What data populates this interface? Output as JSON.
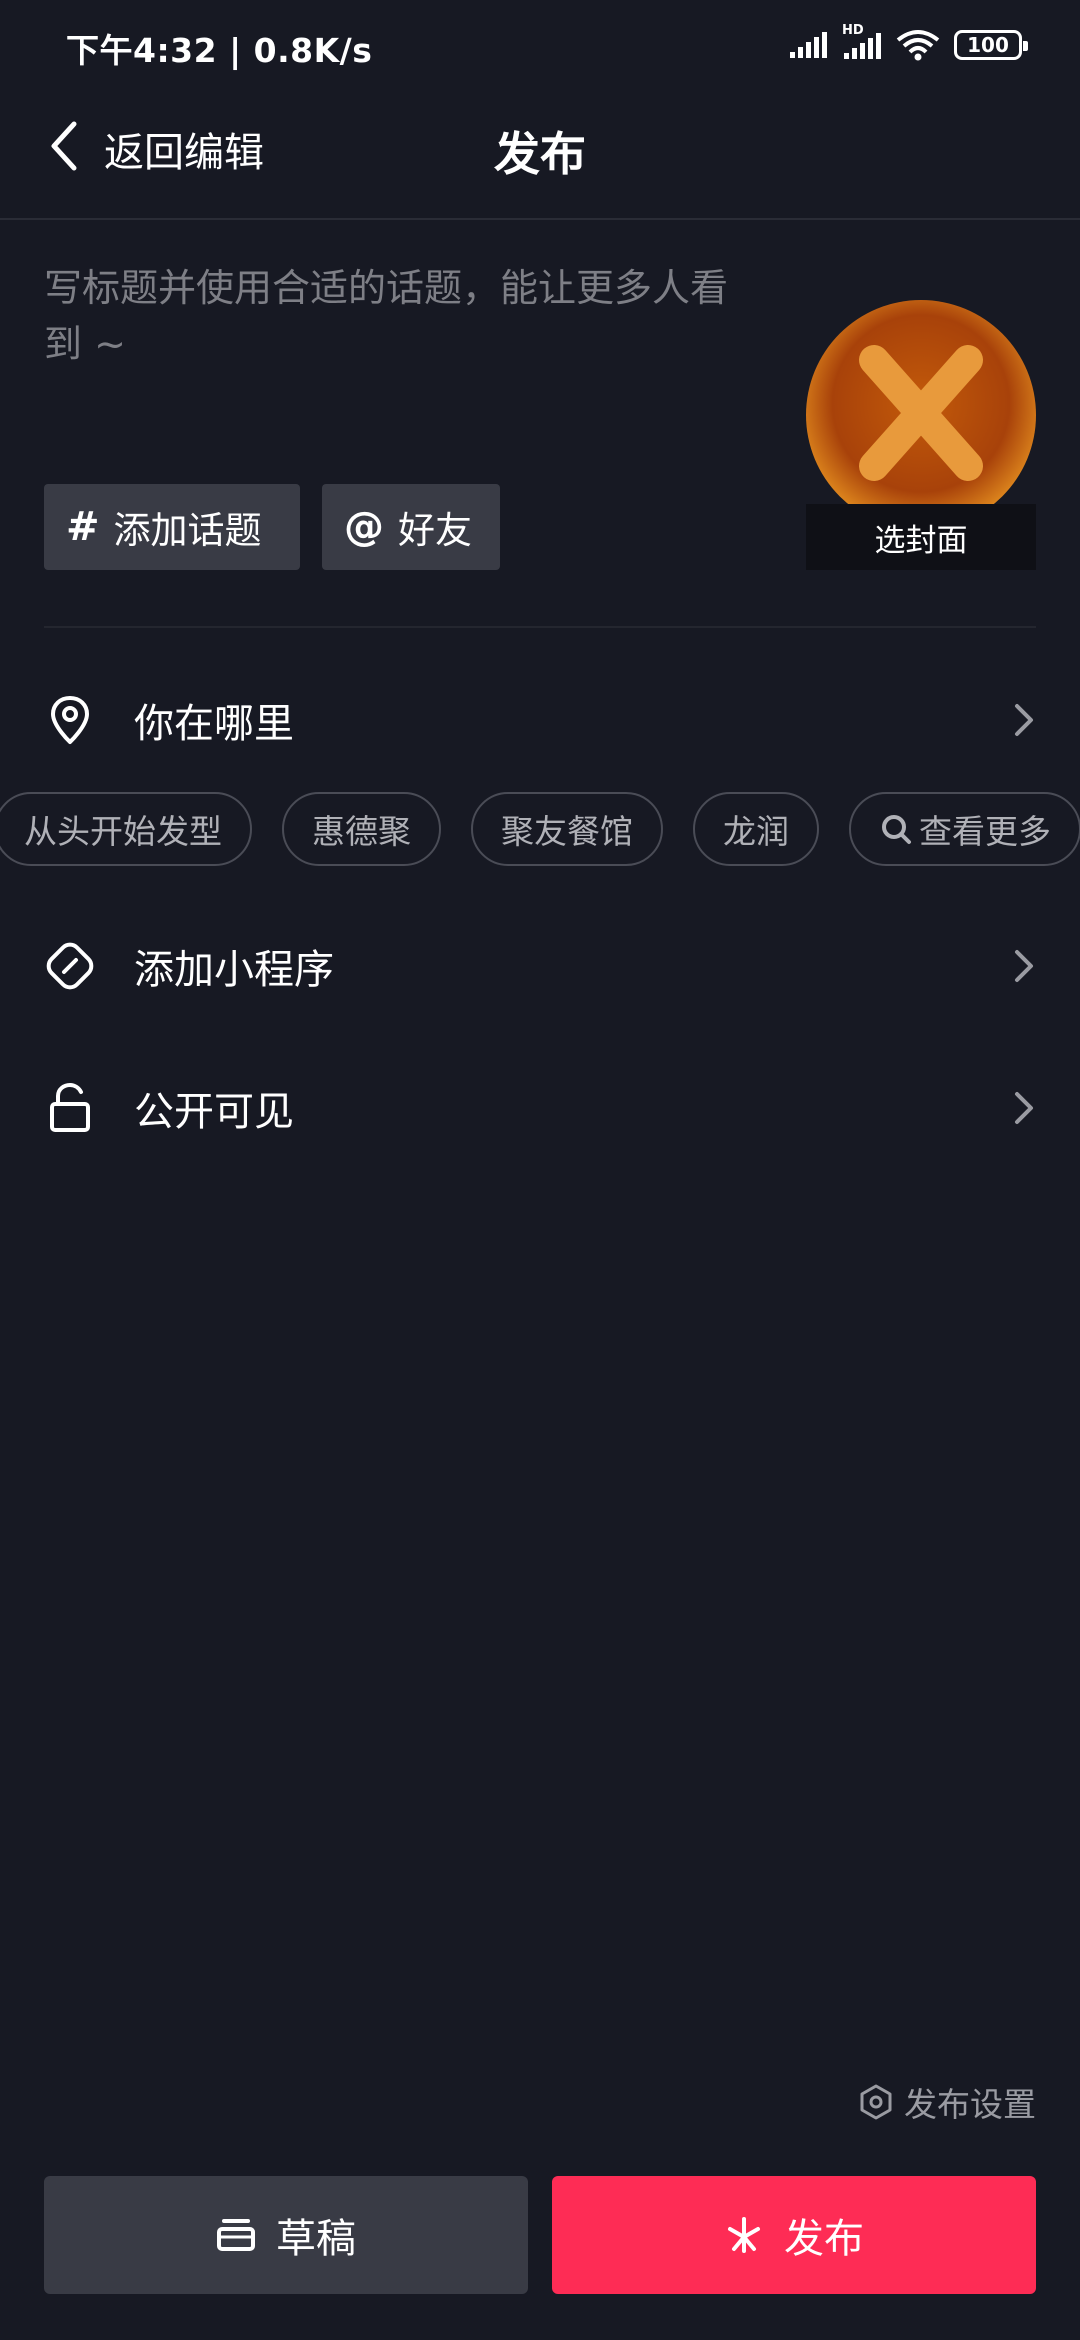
{
  "status_bar": {
    "time": "下午4:32 | 0.8K/s",
    "hd_label": "HD",
    "battery": "100"
  },
  "nav": {
    "back_label": "返回编辑",
    "title": "发布"
  },
  "title_input": {
    "placeholder": "写标题并使用合适的话题，能让更多人看到 ~",
    "value": ""
  },
  "cover": {
    "label": "选封面"
  },
  "tags": {
    "topic_symbol": "#",
    "topic_label": "添加话题",
    "friend_symbol": "@",
    "friend_label": "好友"
  },
  "location": {
    "label": "你在哪里",
    "chips": [
      "从头开始发型",
      "惠德聚",
      "聚友餐馆",
      "龙润"
    ],
    "more_label": "查看更多"
  },
  "mini_program": {
    "label": "添加小程序"
  },
  "visibility": {
    "label": "公开可见"
  },
  "publish_settings": {
    "label": "发布设置"
  },
  "buttons": {
    "draft_label": "草稿",
    "publish_label": "发布"
  },
  "colors": {
    "background": "#171923",
    "publish_accent": "#fe2c55",
    "secondary_button": "#393b45",
    "placeholder_text": "#7e7f86"
  },
  "icons": {
    "back": "chevron-left-icon",
    "location": "location-pin-icon",
    "mini_program": "link-icon",
    "visibility": "unlock-icon",
    "settings": "hexagon-settings-icon",
    "draft": "draft-box-icon",
    "publish": "sparkle-icon",
    "search": "search-icon"
  }
}
